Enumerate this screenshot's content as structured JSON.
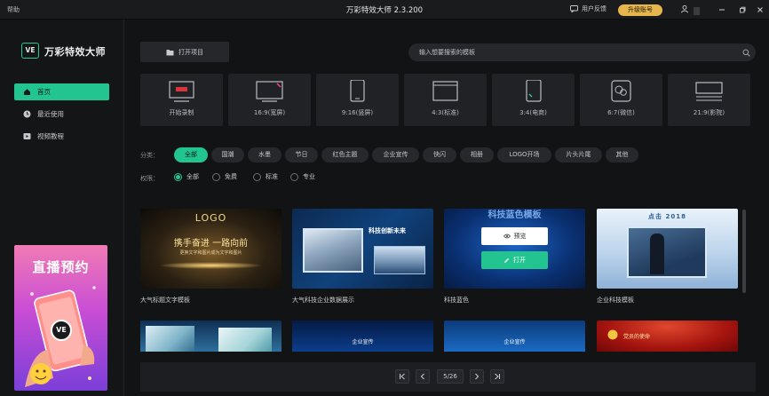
{
  "titlebar": {
    "help": "帮助",
    "title": "万彩特效大师 2.3.200",
    "feedback": "用户反馈",
    "upgrade": "升级账号"
  },
  "sidebar": {
    "logo_mark": "VE",
    "logo_text": "万彩特效大师",
    "items": [
      {
        "label": "首页",
        "icon": "home-icon"
      },
      {
        "label": "最近使用",
        "icon": "clock-icon"
      },
      {
        "label": "视频教程",
        "icon": "video-icon"
      }
    ],
    "promo": {
      "title": "直播预约",
      "badge": "VE"
    }
  },
  "toolbar": {
    "open_project": "打开项目",
    "search_placeholder": "输入想要搜索的模板"
  },
  "ratios": [
    {
      "label": "开始录制"
    },
    {
      "label": "16:9(宽屏)"
    },
    {
      "label": "9:16(竖屏)"
    },
    {
      "label": "4:3(标准)"
    },
    {
      "label": "3:4(电商)"
    },
    {
      "label": "6:7(微信)"
    },
    {
      "label": "21:9(影院)"
    }
  ],
  "filters": {
    "category_label": "分类：",
    "categories": [
      "全部",
      "国潮",
      "水墨",
      "节日",
      "红色主题",
      "企业宣传",
      "快闪",
      "相册",
      "LOGO开场",
      "片头片尾",
      "其他"
    ],
    "permission_label": "权限：",
    "permissions": [
      "全部",
      "免费",
      "标准",
      "专业"
    ]
  },
  "templates": [
    {
      "title": "大气标题文字模板",
      "overlay": [
        "LOGO",
        "携手奋进 一路向前",
        "更换文字和图片成为文字和图片"
      ]
    },
    {
      "title": "大气科技企业数据展示",
      "overlay": [
        "科技创新未来"
      ]
    },
    {
      "title": "科技蓝色",
      "overlay": [
        "科技蓝色模板"
      ],
      "preview": "预览",
      "open": "打开"
    },
    {
      "title": "企业科技模板",
      "overlay": [
        "点击 2018"
      ]
    }
  ],
  "templates_row2": [
    {
      "overlay": ""
    },
    {
      "overlay": "企业宣传"
    },
    {
      "overlay": "企业宣传"
    },
    {
      "overlay": "党员的使命"
    }
  ],
  "pager": {
    "current": "5/26"
  },
  "colors": {
    "accent": "#22c48f",
    "upgrade": "#e6b64d",
    "background": "#121314"
  }
}
